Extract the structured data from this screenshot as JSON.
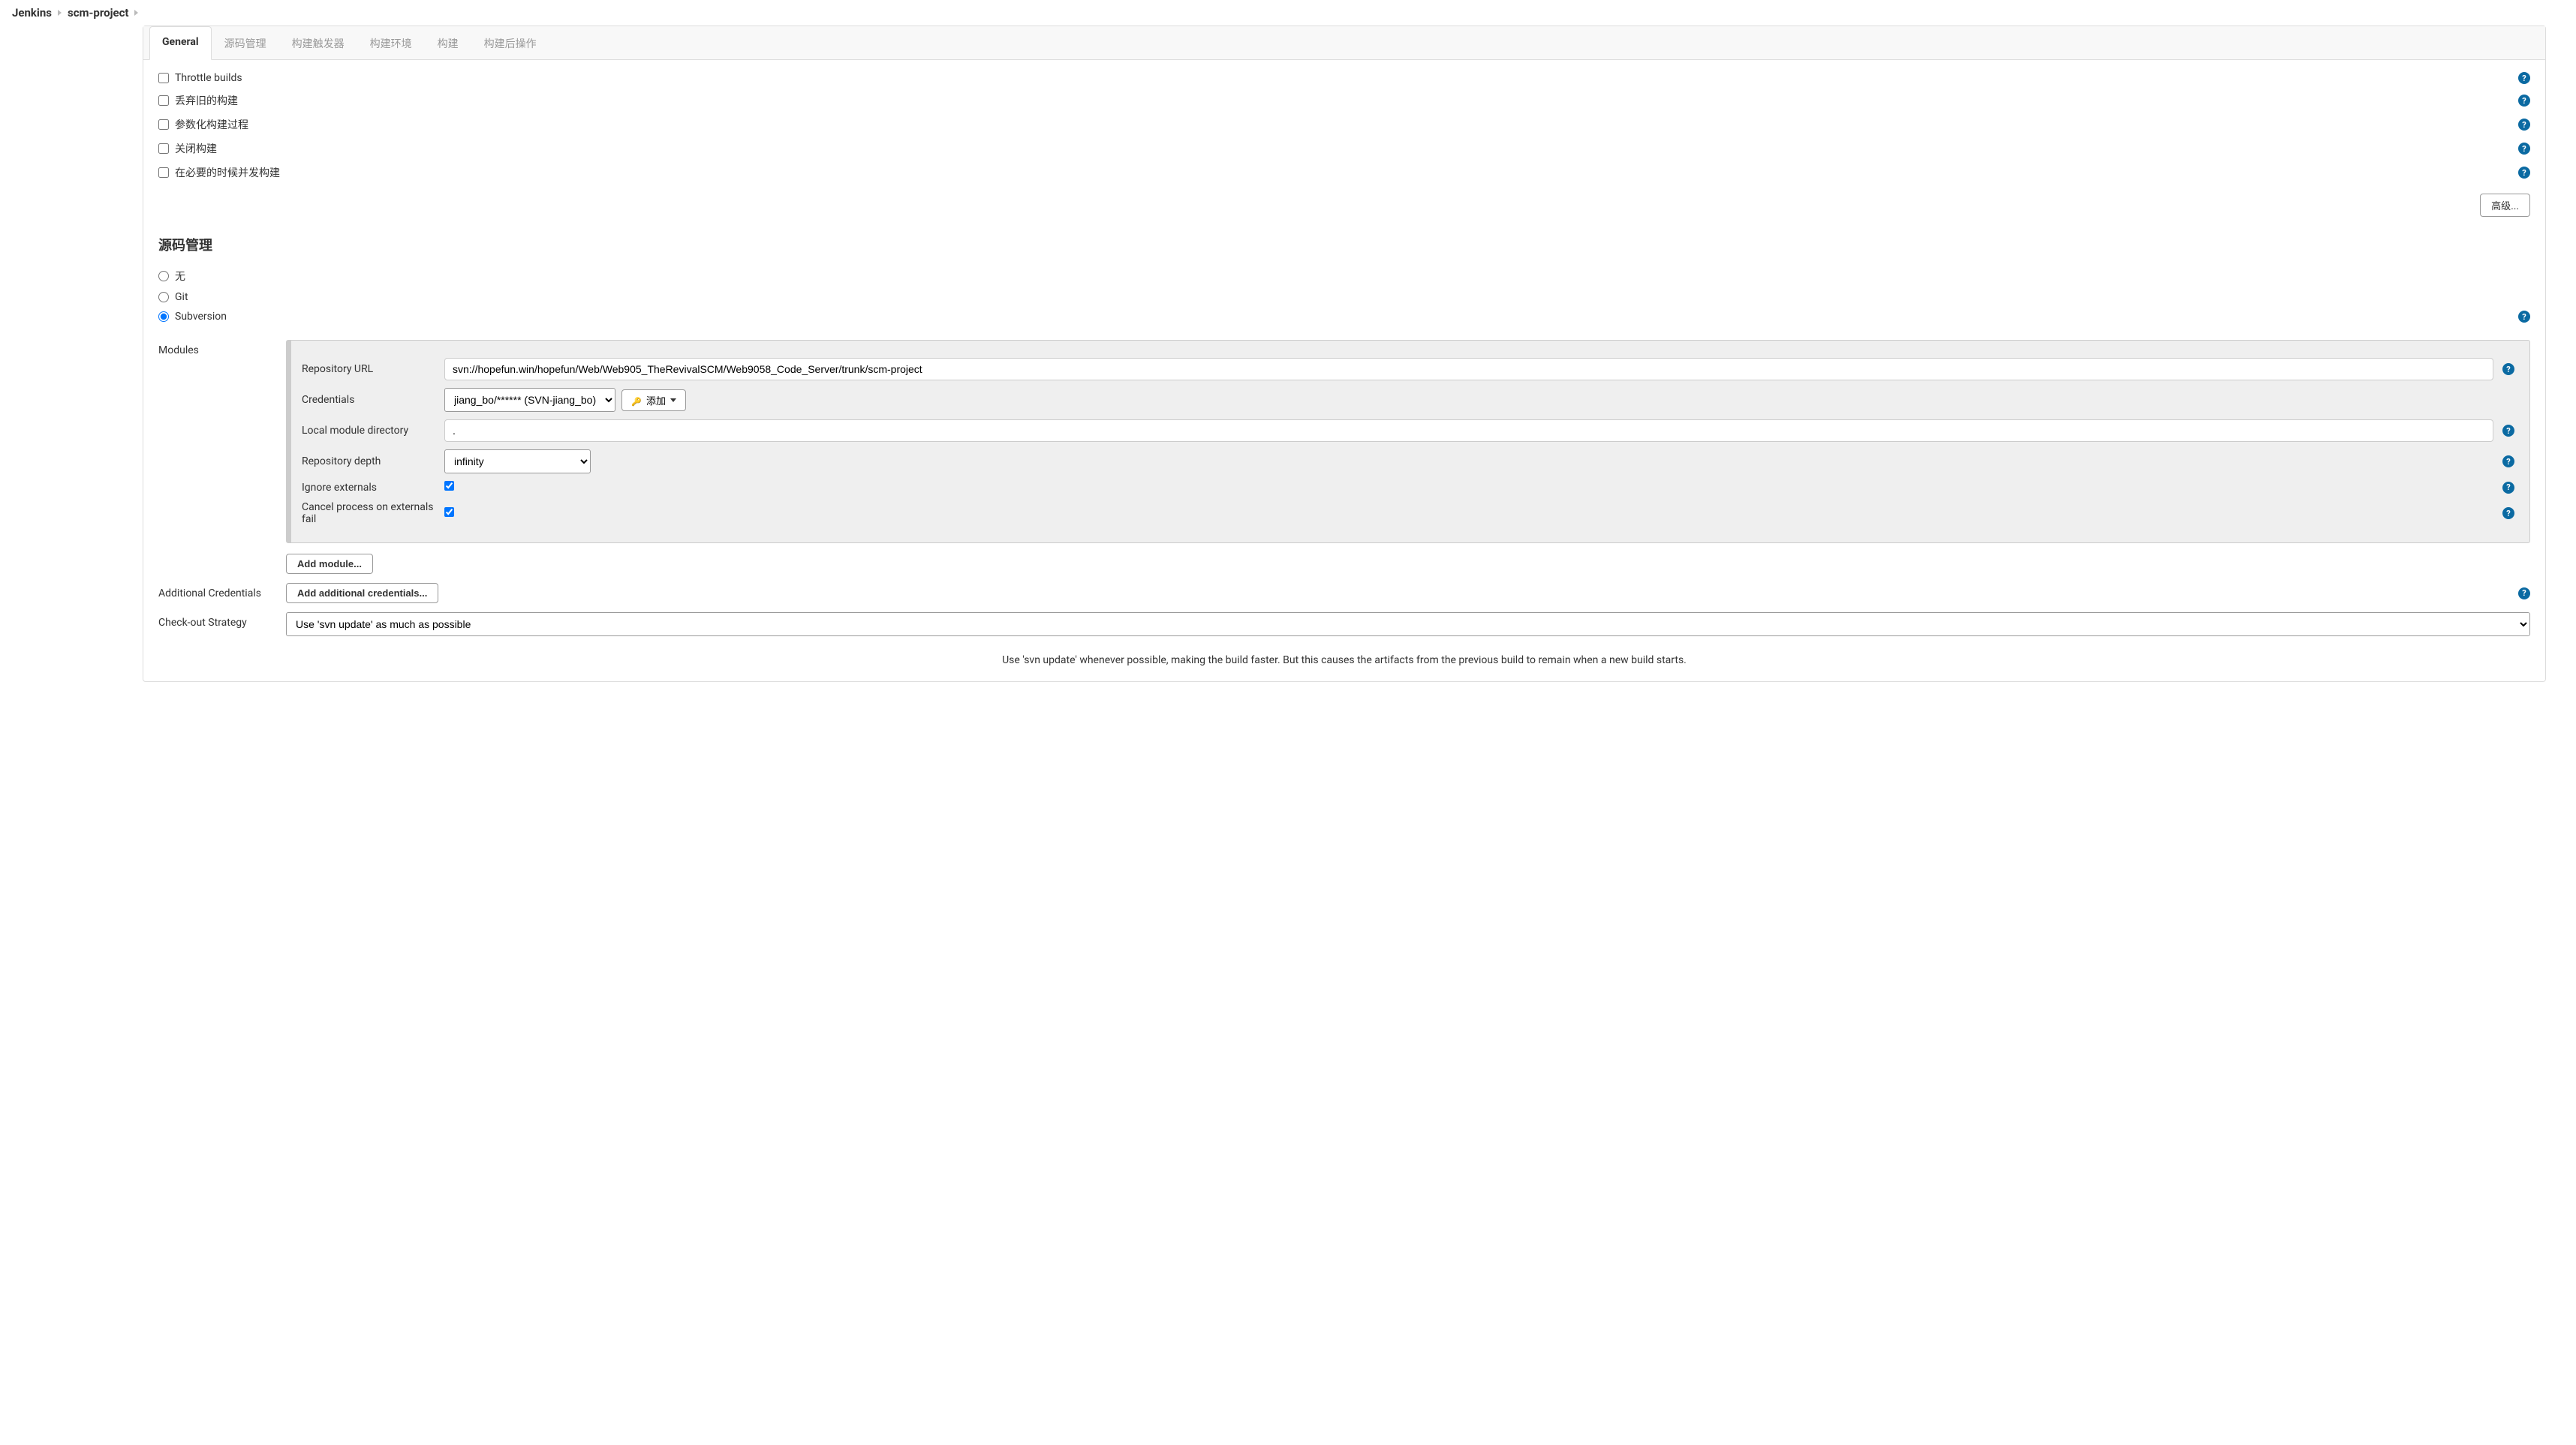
{
  "breadcrumb": {
    "jenkins": "Jenkins",
    "project": "scm-project"
  },
  "tabs": {
    "general": "General",
    "scm": "源码管理",
    "triggers": "构建触发器",
    "env": "构建环境",
    "build": "构建",
    "post": "构建后操作"
  },
  "general": {
    "throttle": "Throttle builds",
    "discard": "丢弃旧的构建",
    "parameterized": "参数化构建过程",
    "disable": "关闭构建",
    "concurrent": "在必要的时候并发构建",
    "advanced": "高级..."
  },
  "scm": {
    "heading": "源码管理",
    "none": "无",
    "git": "Git",
    "svn": "Subversion",
    "modules_label": "Modules",
    "repo_url_label": "Repository URL",
    "repo_url_value": "svn://hopefun.win/hopefun/Web/Web905_TheRevivalSCM/Web9058_Code_Server/trunk/scm-project",
    "credentials_label": "Credentials",
    "credentials_value": "jiang_bo/****** (SVN-jiang_bo)",
    "add_credential": "添加",
    "local_dir_label": "Local module directory",
    "local_dir_value": ".",
    "depth_label": "Repository depth",
    "depth_value": "infinity",
    "ignore_ext_label": "Ignore externals",
    "cancel_ext_label": "Cancel process on externals fail",
    "add_module": "Add module...",
    "additional_creds_label": "Additional Credentials",
    "add_additional_creds": "Add additional credentials...",
    "checkout_label": "Check-out Strategy",
    "checkout_value": "Use 'svn update' as much as possible",
    "checkout_desc": "Use 'svn update' whenever possible, making the build faster. But this causes the artifacts from the previous build to remain when a new build starts."
  }
}
